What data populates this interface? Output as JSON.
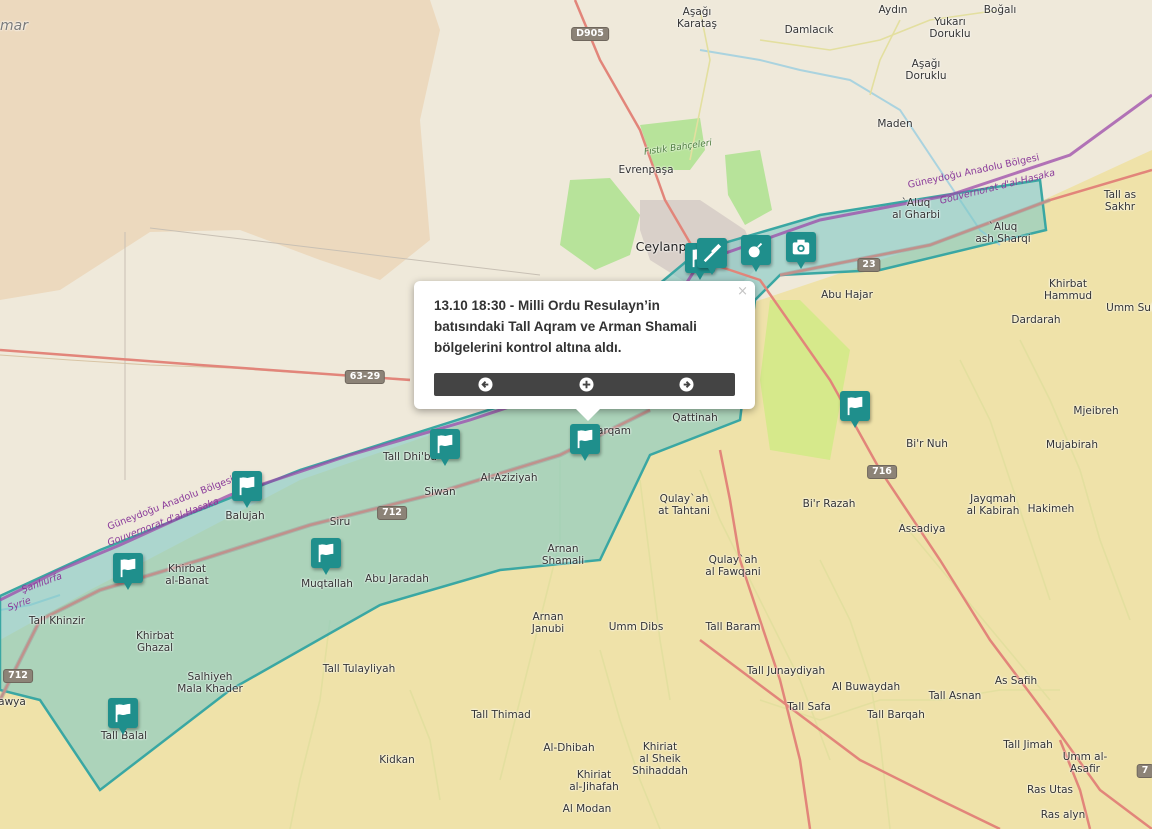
{
  "popup": {
    "text": "13.10 18:30 - Milli Ordu Resulayn’in batısındaki Tall Aqram ve Arman Shamali bölgelerini kontrol altına aldı.",
    "close_symbol": "×",
    "nav_icons": [
      "arrow-left-icon",
      "plus-icon",
      "arrow-right-icon"
    ]
  },
  "colors": {
    "land": "#f2efe9",
    "syria_land": "#efe2a9",
    "turkey_land": "#efe9da",
    "zone_fill": "#7fcac6",
    "zone_border": "#3aa7a3",
    "marker": "#1f8f8c",
    "road_major": "#e2857a",
    "road_minor": "#f6fabb",
    "border": "#9c4aa9",
    "popup_nav": "#444444"
  },
  "places": [
    {
      "name": "Aşağı",
      "name2": "Karataş"
    },
    {
      "name": "Aydın"
    },
    {
      "name": "Yukarı",
      "name2": "Doruklu"
    },
    {
      "name": "Boğalı"
    },
    {
      "name": "Damlacık"
    },
    {
      "name": "Aşağı",
      "name2": "Doruklu"
    },
    {
      "name": "Maden"
    },
    {
      "name": "Fıstık Bahçeleri"
    },
    {
      "name": "Evrenpaşa"
    },
    {
      "name": "Ceylanp"
    },
    {
      "name": "`Aluq",
      "name2": "al Gharbi"
    },
    {
      "name": "`Aluq",
      "name2": "ash Sharqi"
    },
    {
      "name": "Tall as",
      "name2": "Sakhr"
    },
    {
      "name": "Abu Hajar"
    },
    {
      "name": "Khirbat",
      "name2": "Hammud"
    },
    {
      "name": "Umm Sul"
    },
    {
      "name": "Dardarah"
    },
    {
      "name": "Mjeibreh"
    },
    {
      "name": "Mujabirah"
    },
    {
      "name": "Qattinah"
    },
    {
      "name": "Bi'r Nuh"
    },
    {
      "name": "Tall Dhi'ba"
    },
    {
      "name": "arqam"
    },
    {
      "name": "Siwan"
    },
    {
      "name": "Al-Aziziyah"
    },
    {
      "name": "Qulay`ah",
      "name2": "at Tahtani"
    },
    {
      "name": "Bi'r Razah"
    },
    {
      "name": "Jayqmah",
      "name2": "al Kabirah"
    },
    {
      "name": "Hakimeh"
    },
    {
      "name": "Balujah"
    },
    {
      "name": "Siru"
    },
    {
      "name": "Assadiya"
    },
    {
      "name": "Arnan",
      "name2": "Shamali"
    },
    {
      "name": "Khirbat",
      "name2": "al-Banat"
    },
    {
      "name": "Muqtallah"
    },
    {
      "name": "Abu Jaradah"
    },
    {
      "name": "Qulay`ah",
      "name2": "al Fawqani"
    },
    {
      "name": "Tall Khinzir"
    },
    {
      "name": "Arnan",
      "name2": "Janubi"
    },
    {
      "name": "Umm Dibs"
    },
    {
      "name": "Tall Baram"
    },
    {
      "name": "Khirbat",
      "name2": "Ghazal"
    },
    {
      "name": "Tall Tulayliyah"
    },
    {
      "name": "Tall Junaydiyah"
    },
    {
      "name": "As Safih"
    },
    {
      "name": "Salhiyeh",
      "name2": "Mala Khader"
    },
    {
      "name": "Al Buwaydah"
    },
    {
      "name": "Tall Asnan"
    },
    {
      "name": "Tall Safa"
    },
    {
      "name": "Tall Barqah"
    },
    {
      "name": "awya"
    },
    {
      "name": "Tall Balal"
    },
    {
      "name": "Tall Thimad"
    },
    {
      "name": "Khiriat",
      "name2": "al Sheik",
      "name3": "Shihaddah"
    },
    {
      "name": "Al-Dhibah"
    },
    {
      "name": "Tall Jimah"
    },
    {
      "name": "Umm al-",
      "name2": "Asafir"
    },
    {
      "name": "Kidkan"
    },
    {
      "name": "Khiriat",
      "name2": "al-Jihafah"
    },
    {
      "name": "Ras Utas"
    },
    {
      "name": "Al Modan"
    },
    {
      "name": "Ras alyn"
    },
    {
      "name": "mar"
    }
  ],
  "road_shields": [
    "D905",
    "63-29",
    "23",
    "712",
    "716",
    "712",
    "7"
  ],
  "admin_labels": [
    "Güneydoğu Anadolu Bölgesi",
    "Gouvernorat d'al-Hasaka",
    "Güneydoğu Anadolu Bölgesi",
    "Gouvernorat d'al-Hasaka",
    "Syrie",
    "Şanlıurfa"
  ],
  "markers": [
    {
      "icon": "flag-icon"
    },
    {
      "icon": "flag-icon"
    },
    {
      "icon": "flag-icon"
    },
    {
      "icon": "flag-icon"
    },
    {
      "icon": "flag-icon"
    },
    {
      "icon": "flag-icon"
    },
    {
      "icon": "flag-icon"
    },
    {
      "icon": "flag-icon"
    },
    {
      "icon": "rifle-icon"
    },
    {
      "icon": "bomb-icon"
    },
    {
      "icon": "camera-icon"
    }
  ]
}
